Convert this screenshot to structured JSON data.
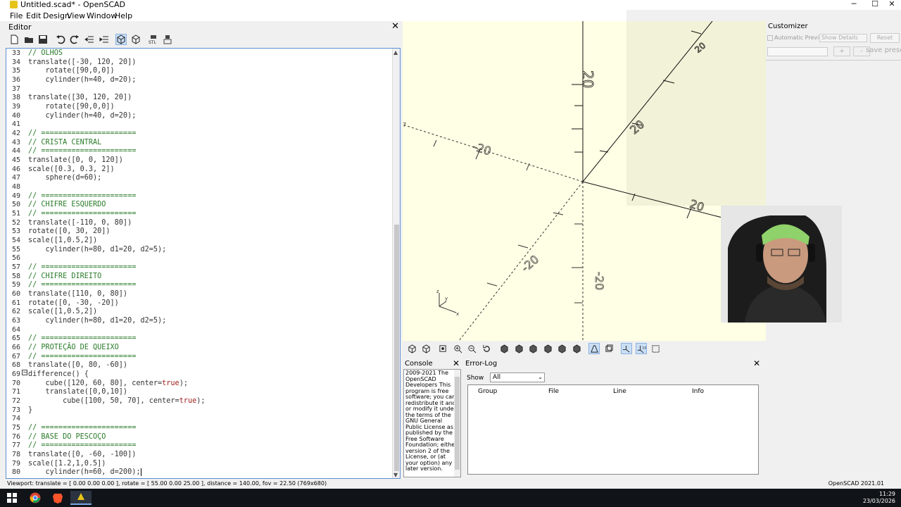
{
  "window": {
    "title": "Untitled.scad* - OpenSCAD",
    "minimize": "─",
    "maximize": "☐",
    "close": "✕"
  },
  "menu": [
    "File",
    "Edit",
    "Design",
    "View",
    "Window",
    "Help"
  ],
  "editor": {
    "title": "Editor",
    "close": "✕",
    "toolbar": [
      "new-icon",
      "open-icon",
      "save-icon",
      "undo-icon",
      "redo-icon",
      "unindent-icon",
      "indent-icon",
      "preview-icon",
      "render-icon",
      "export-stl-icon",
      "send-to-print-icon"
    ],
    "lines": [
      {
        "n": "33",
        "t": "// OLHOS",
        "c": true
      },
      {
        "n": "34",
        "t": "translate([-30, 120, 20])"
      },
      {
        "n": "35",
        "t": "    rotate([90,0,0])"
      },
      {
        "n": "36",
        "t": "    cylinder(h=40, d=20);"
      },
      {
        "n": "37",
        "t": ""
      },
      {
        "n": "38",
        "t": "translate([30, 120, 20])"
      },
      {
        "n": "39",
        "t": "    rotate([90,0,0])"
      },
      {
        "n": "40",
        "t": "    cylinder(h=40, d=20);"
      },
      {
        "n": "41",
        "t": ""
      },
      {
        "n": "42",
        "t": "// ======================",
        "c": true
      },
      {
        "n": "43",
        "t": "// CRISTA CENTRAL",
        "c": true
      },
      {
        "n": "44",
        "t": "// ======================",
        "c": true
      },
      {
        "n": "45",
        "t": "translate([0, 0, 120])"
      },
      {
        "n": "46",
        "t": "scale([0.3, 0.3, 2])"
      },
      {
        "n": "47",
        "t": "    sphere(d=60);"
      },
      {
        "n": "48",
        "t": ""
      },
      {
        "n": "49",
        "t": "// ======================",
        "c": true
      },
      {
        "n": "50",
        "t": "// CHIFRE ESQUERDO",
        "c": true
      },
      {
        "n": "51",
        "t": "// ======================",
        "c": true
      },
      {
        "n": "52",
        "t": "translate([-110, 0, 80])"
      },
      {
        "n": "53",
        "t": "rotate([0, 30, 20])"
      },
      {
        "n": "54",
        "t": "scale([1,0.5,2])"
      },
      {
        "n": "55",
        "t": "    cylinder(h=80, d1=20, d2=5);"
      },
      {
        "n": "56",
        "t": ""
      },
      {
        "n": "57",
        "t": "// ======================",
        "c": true
      },
      {
        "n": "58",
        "t": "// CHIFRE DIREITO",
        "c": true
      },
      {
        "n": "59",
        "t": "// ======================",
        "c": true
      },
      {
        "n": "60",
        "t": "translate([110, 0, 80])"
      },
      {
        "n": "61",
        "t": "rotate([0, -30, -20])"
      },
      {
        "n": "62",
        "t": "scale([1,0.5,2])"
      },
      {
        "n": "63",
        "t": "    cylinder(h=80, d1=20, d2=5);"
      },
      {
        "n": "64",
        "t": ""
      },
      {
        "n": "65",
        "t": "// ======================",
        "c": true
      },
      {
        "n": "66",
        "t": "// PROTEÇÃO DE QUEIXO",
        "c": true
      },
      {
        "n": "67",
        "t": "// ======================",
        "c": true
      },
      {
        "n": "68",
        "t": "translate([0, 80, -60])"
      },
      {
        "n": "69",
        "t": "difference() {"
      },
      {
        "n": "70",
        "t": "    cube([120, 60, 80], center=true);"
      },
      {
        "n": "71",
        "t": "    translate([0,0,10])"
      },
      {
        "n": "72",
        "t": "        cube([100, 50, 70], center=true);"
      },
      {
        "n": "73",
        "t": "}"
      },
      {
        "n": "74",
        "t": ""
      },
      {
        "n": "75",
        "t": "// ======================",
        "c": true
      },
      {
        "n": "76",
        "t": "// BASE DO PESCOÇO",
        "c": true
      },
      {
        "n": "77",
        "t": "// ======================",
        "c": true
      },
      {
        "n": "78",
        "t": "translate([0, -60, -100])"
      },
      {
        "n": "79",
        "t": "scale([1.2,1,0.5])"
      },
      {
        "n": "80",
        "t": "    cylinder(h=60, d=200);"
      }
    ]
  },
  "viewport": {
    "axis_labels": [
      "20",
      "20",
      "-20",
      "20",
      "-20",
      "-20",
      "20"
    ],
    "axis_gizmo": {
      "z": "z",
      "y": "y",
      "x": "x"
    }
  },
  "view_toolbar": [
    "preview-icon",
    "render-icon",
    "view-all-icon",
    "zoom-in-icon",
    "zoom-out-icon",
    "reset-view-icon",
    "view-right-icon",
    "view-top-icon",
    "view-bottom-icon",
    "view-left-icon",
    "view-front-icon",
    "view-back-icon",
    "perspective-icon",
    "orthogonal-icon",
    "show-axes-icon",
    "show-scale-icon",
    "show-edges-icon"
  ],
  "console": {
    "title": "Console",
    "close": "✕",
    "text": "2009-2021 The OpenSCAD Developers This program is free software; you can redistribute it and/ or modify it under the terms of the GNU General Public License as published by the Free Software Foundation; either version 2 of the License, or (at your option) any later version."
  },
  "error_log": {
    "title": "Error-Log",
    "close": "✕",
    "show_label": "Show",
    "show_value": "All",
    "columns": [
      "Group",
      "File",
      "Line",
      "Info"
    ]
  },
  "customizer": {
    "title": "Customizer",
    "automatic_preview": "Automatic Preview",
    "show_details": "Show Details",
    "reset": "Reset",
    "plus": "+",
    "minus": "-",
    "save_preset": "save prese"
  },
  "status": {
    "left": "Viewport: translate = [ 0.00 0.00 0.00 ], rotate = [ 55.00 0.00 25.00 ], distance = 140.00, fov = 22.50 (769x680)",
    "right": "OpenSCAD 2021.01"
  },
  "taskbar": {
    "apps": [
      "windows-start-icon",
      "chrome-icon",
      "brave-icon",
      "openscad-icon"
    ],
    "time": "11:29",
    "date": "23/03/2026"
  },
  "colors": {
    "viewport_bg": "#ffffe5",
    "comment": "#2a7a2a",
    "selection_border": "#5b8fd0",
    "taskbar": "#101418"
  }
}
